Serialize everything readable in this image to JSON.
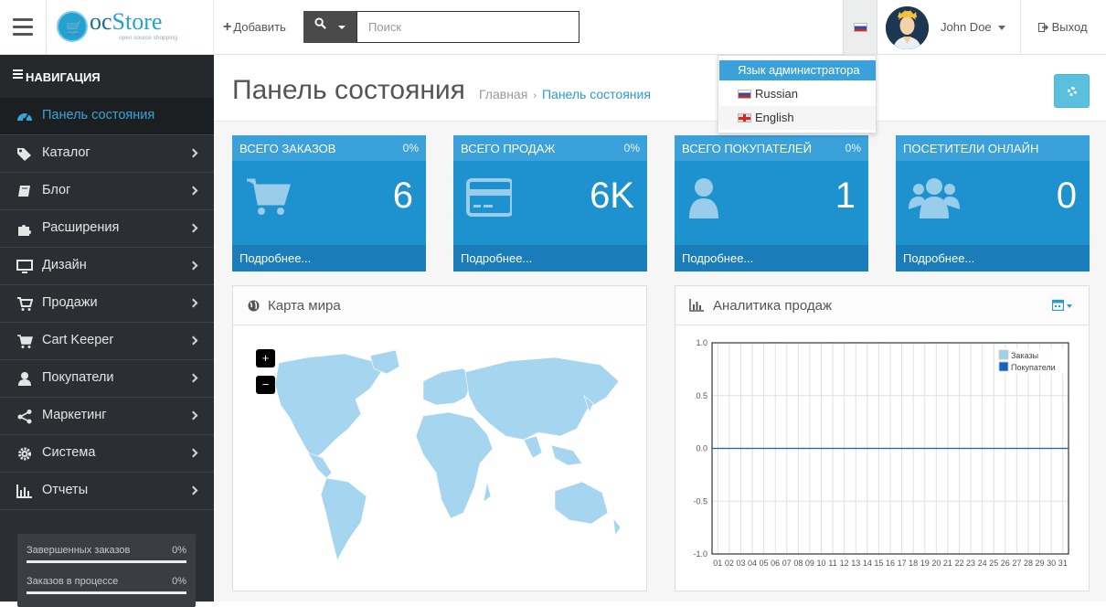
{
  "header": {
    "logo_text": "ocStore",
    "logo_sub": "open source shopping",
    "add_label": "Добавить",
    "search_placeholder": "Поиск",
    "user_name": "John Doe",
    "logout_label": "Выход"
  },
  "lang_menu": {
    "header": "Язык администратора",
    "items": [
      "Russian",
      "English"
    ]
  },
  "sidebar": {
    "heading": "НАВИГАЦИЯ",
    "items": [
      {
        "label": "Панель состояния",
        "icon": "dashboard-icon",
        "active": true
      },
      {
        "label": "Каталог",
        "icon": "tags-icon"
      },
      {
        "label": "Блог",
        "icon": "book-icon"
      },
      {
        "label": "Расширения",
        "icon": "puzzle-icon"
      },
      {
        "label": "Дизайн",
        "icon": "desktop-icon"
      },
      {
        "label": "Продажи",
        "icon": "cart-icon"
      },
      {
        "label": "Cart Keeper",
        "icon": "cart-arrow-icon"
      },
      {
        "label": "Покупатели",
        "icon": "user-icon"
      },
      {
        "label": "Маркетинг",
        "icon": "share-icon"
      },
      {
        "label": "Система",
        "icon": "gear-icon"
      },
      {
        "label": "Отчеты",
        "icon": "bar-chart-icon"
      }
    ],
    "stats": [
      {
        "label": "Завершенных заказов",
        "value": "0%"
      },
      {
        "label": "Заказов в процессе",
        "value": "0%"
      }
    ]
  },
  "page": {
    "title": "Панель состояния",
    "breadcrumb": [
      "Главная",
      "Панель состояния"
    ]
  },
  "tiles": [
    {
      "title": "ВСЕГО ЗАКАЗОВ",
      "percent": "0%",
      "value": "6",
      "footer": "Подробнее...",
      "icon": "cart-icon"
    },
    {
      "title": "ВСЕГО ПРОДАЖ",
      "percent": "0%",
      "value": "6K",
      "footer": "Подробнее...",
      "icon": "credit-card-icon"
    },
    {
      "title": "ВСЕГО ПОКУПАТЕЛЕЙ",
      "percent": "0%",
      "value": "1",
      "footer": "Подробнее...",
      "icon": "user-icon"
    },
    {
      "title": "ПОСЕТИТЕЛИ ОНЛАЙН",
      "percent": "",
      "value": "0",
      "footer": "Подробнее...",
      "icon": "users-icon"
    }
  ],
  "map_panel": {
    "title": "Карта мира",
    "zoom_in": "+",
    "zoom_out": "−"
  },
  "chart_panel": {
    "title": "Аналитика продаж"
  },
  "colors": {
    "accent": "#1e91cf",
    "sidebar": "#2b2f33",
    "orders": "#9fd1ea",
    "customers": "#1565c0"
  },
  "chart_data": {
    "type": "line",
    "x": [
      "01",
      "02",
      "03",
      "04",
      "05",
      "06",
      "07",
      "08",
      "09",
      "10",
      "11",
      "12",
      "13",
      "14",
      "15",
      "16",
      "17",
      "18",
      "19",
      "20",
      "21",
      "22",
      "23",
      "24",
      "25",
      "26",
      "27",
      "28",
      "29",
      "30",
      "31"
    ],
    "series": [
      {
        "name": "Заказы",
        "values": [
          0,
          0,
          0,
          0,
          0,
          0,
          0,
          0,
          0,
          0,
          0,
          0,
          0,
          0,
          0,
          0,
          0,
          0,
          0,
          0,
          0,
          0,
          0,
          0,
          0,
          0,
          0,
          0,
          0,
          0,
          0
        ]
      },
      {
        "name": "Покупатели",
        "values": [
          0,
          0,
          0,
          0,
          0,
          0,
          0,
          0,
          0,
          0,
          0,
          0,
          0,
          0,
          0,
          0,
          0,
          0,
          0,
          0,
          0,
          0,
          0,
          0,
          0,
          0,
          0,
          0,
          0,
          0,
          0
        ]
      }
    ],
    "yticks": [
      "1.0",
      "0.5",
      "0.0",
      "-0.5",
      "-1.0"
    ],
    "ylim": [
      -1,
      1
    ],
    "grid": true,
    "legend": "top-right"
  }
}
